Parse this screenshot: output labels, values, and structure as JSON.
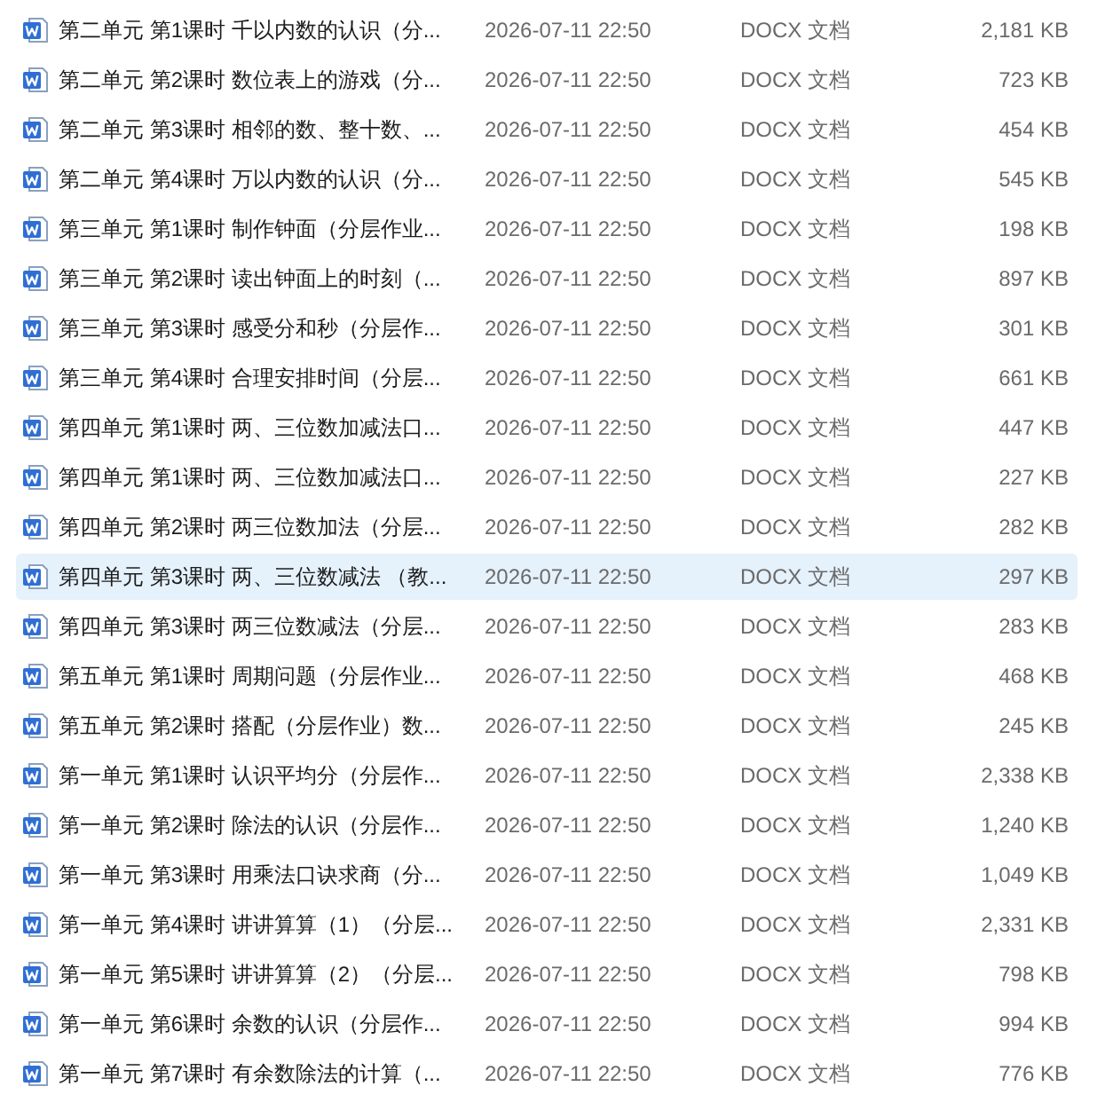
{
  "files": [
    {
      "name": "第二单元 第1课时 千以内数的认识（分...",
      "modified": "2026-07-11 22:50",
      "type": "DOCX 文档",
      "size": "2,181 KB",
      "selected": false
    },
    {
      "name": "第二单元 第2课时 数位表上的游戏（分...",
      "modified": "2026-07-11 22:50",
      "type": "DOCX 文档",
      "size": "723 KB",
      "selected": false
    },
    {
      "name": "第二单元 第3课时 相邻的数、整十数、...",
      "modified": "2026-07-11 22:50",
      "type": "DOCX 文档",
      "size": "454 KB",
      "selected": false
    },
    {
      "name": "第二单元 第4课时 万以内数的认识（分...",
      "modified": "2026-07-11 22:50",
      "type": "DOCX 文档",
      "size": "545 KB",
      "selected": false
    },
    {
      "name": "第三单元 第1课时 制作钟面（分层作业...",
      "modified": "2026-07-11 22:50",
      "type": "DOCX 文档",
      "size": "198 KB",
      "selected": false
    },
    {
      "name": "第三单元 第2课时 读出钟面上的时刻（...",
      "modified": "2026-07-11 22:50",
      "type": "DOCX 文档",
      "size": "897 KB",
      "selected": false
    },
    {
      "name": "第三单元 第3课时 感受分和秒（分层作...",
      "modified": "2026-07-11 22:50",
      "type": "DOCX 文档",
      "size": "301 KB",
      "selected": false
    },
    {
      "name": "第三单元 第4课时 合理安排时间（分层...",
      "modified": "2026-07-11 22:50",
      "type": "DOCX 文档",
      "size": "661 KB",
      "selected": false
    },
    {
      "name": "第四单元 第1课时 两、三位数加减法口...",
      "modified": "2026-07-11 22:50",
      "type": "DOCX 文档",
      "size": "447 KB",
      "selected": false
    },
    {
      "name": "第四单元 第1课时 两、三位数加减法口...",
      "modified": "2026-07-11 22:50",
      "type": "DOCX 文档",
      "size": "227 KB",
      "selected": false
    },
    {
      "name": "第四单元 第2课时 两三位数加法（分层...",
      "modified": "2026-07-11 22:50",
      "type": "DOCX 文档",
      "size": "282 KB",
      "selected": false
    },
    {
      "name": "第四单元 第3课时 两、三位数减法 （教...",
      "modified": "2026-07-11 22:50",
      "type": "DOCX 文档",
      "size": "297 KB",
      "selected": true
    },
    {
      "name": "第四单元 第3课时 两三位数减法（分层...",
      "modified": "2026-07-11 22:50",
      "type": "DOCX 文档",
      "size": "283 KB",
      "selected": false
    },
    {
      "name": "第五单元 第1课时 周期问题（分层作业...",
      "modified": "2026-07-11 22:50",
      "type": "DOCX 文档",
      "size": "468 KB",
      "selected": false
    },
    {
      "name": "第五单元 第2课时 搭配（分层作业）数...",
      "modified": "2026-07-11 22:50",
      "type": "DOCX 文档",
      "size": "245 KB",
      "selected": false
    },
    {
      "name": "第一单元 第1课时 认识平均分（分层作...",
      "modified": "2026-07-11 22:50",
      "type": "DOCX 文档",
      "size": "2,338 KB",
      "selected": false
    },
    {
      "name": "第一单元 第2课时 除法的认识（分层作...",
      "modified": "2026-07-11 22:50",
      "type": "DOCX 文档",
      "size": "1,240 KB",
      "selected": false
    },
    {
      "name": "第一单元 第3课时 用乘法口诀求商（分...",
      "modified": "2026-07-11 22:50",
      "type": "DOCX 文档",
      "size": "1,049 KB",
      "selected": false
    },
    {
      "name": "第一单元 第4课时 讲讲算算（1）（分层...",
      "modified": "2026-07-11 22:50",
      "type": "DOCX 文档",
      "size": "2,331 KB",
      "selected": false
    },
    {
      "name": "第一单元 第5课时 讲讲算算（2）（分层...",
      "modified": "2026-07-11 22:50",
      "type": "DOCX 文档",
      "size": "798 KB",
      "selected": false
    },
    {
      "name": "第一单元 第6课时 余数的认识（分层作...",
      "modified": "2026-07-11 22:50",
      "type": "DOCX 文档",
      "size": "994 KB",
      "selected": false
    },
    {
      "name": "第一单元 第7课时 有余数除法的计算（...",
      "modified": "2026-07-11 22:50",
      "type": "DOCX 文档",
      "size": "776 KB",
      "selected": false
    }
  ]
}
